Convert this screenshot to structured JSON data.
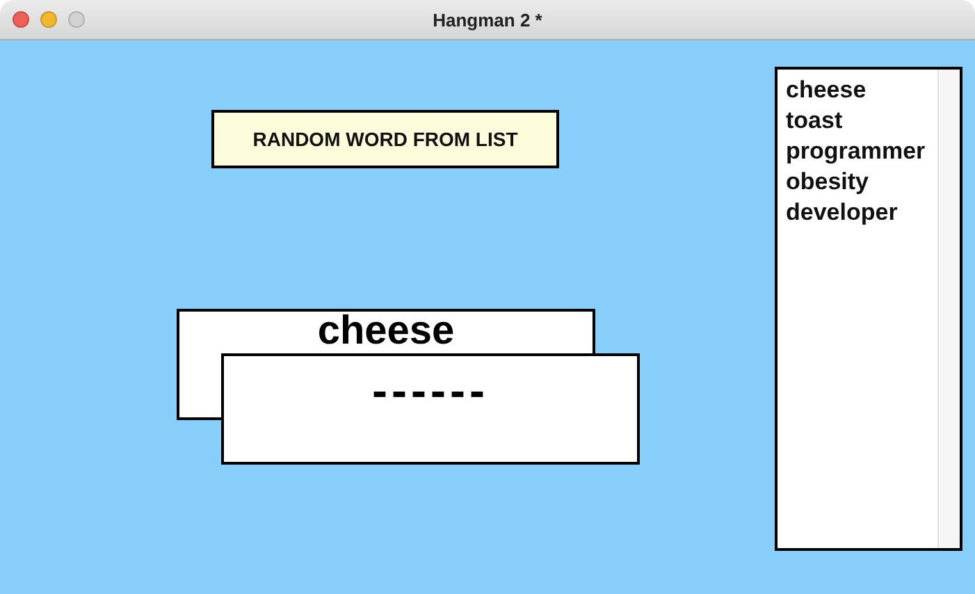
{
  "window": {
    "title": "Hangman 2 *"
  },
  "random_button": {
    "label": "RANDOM WORD FROM LIST"
  },
  "secret_word": {
    "text": "cheese"
  },
  "masked_word": {
    "text": "------"
  },
  "word_list": {
    "items": [
      "cheese",
      "toast",
      "programmer",
      "obesity",
      "developer"
    ]
  }
}
